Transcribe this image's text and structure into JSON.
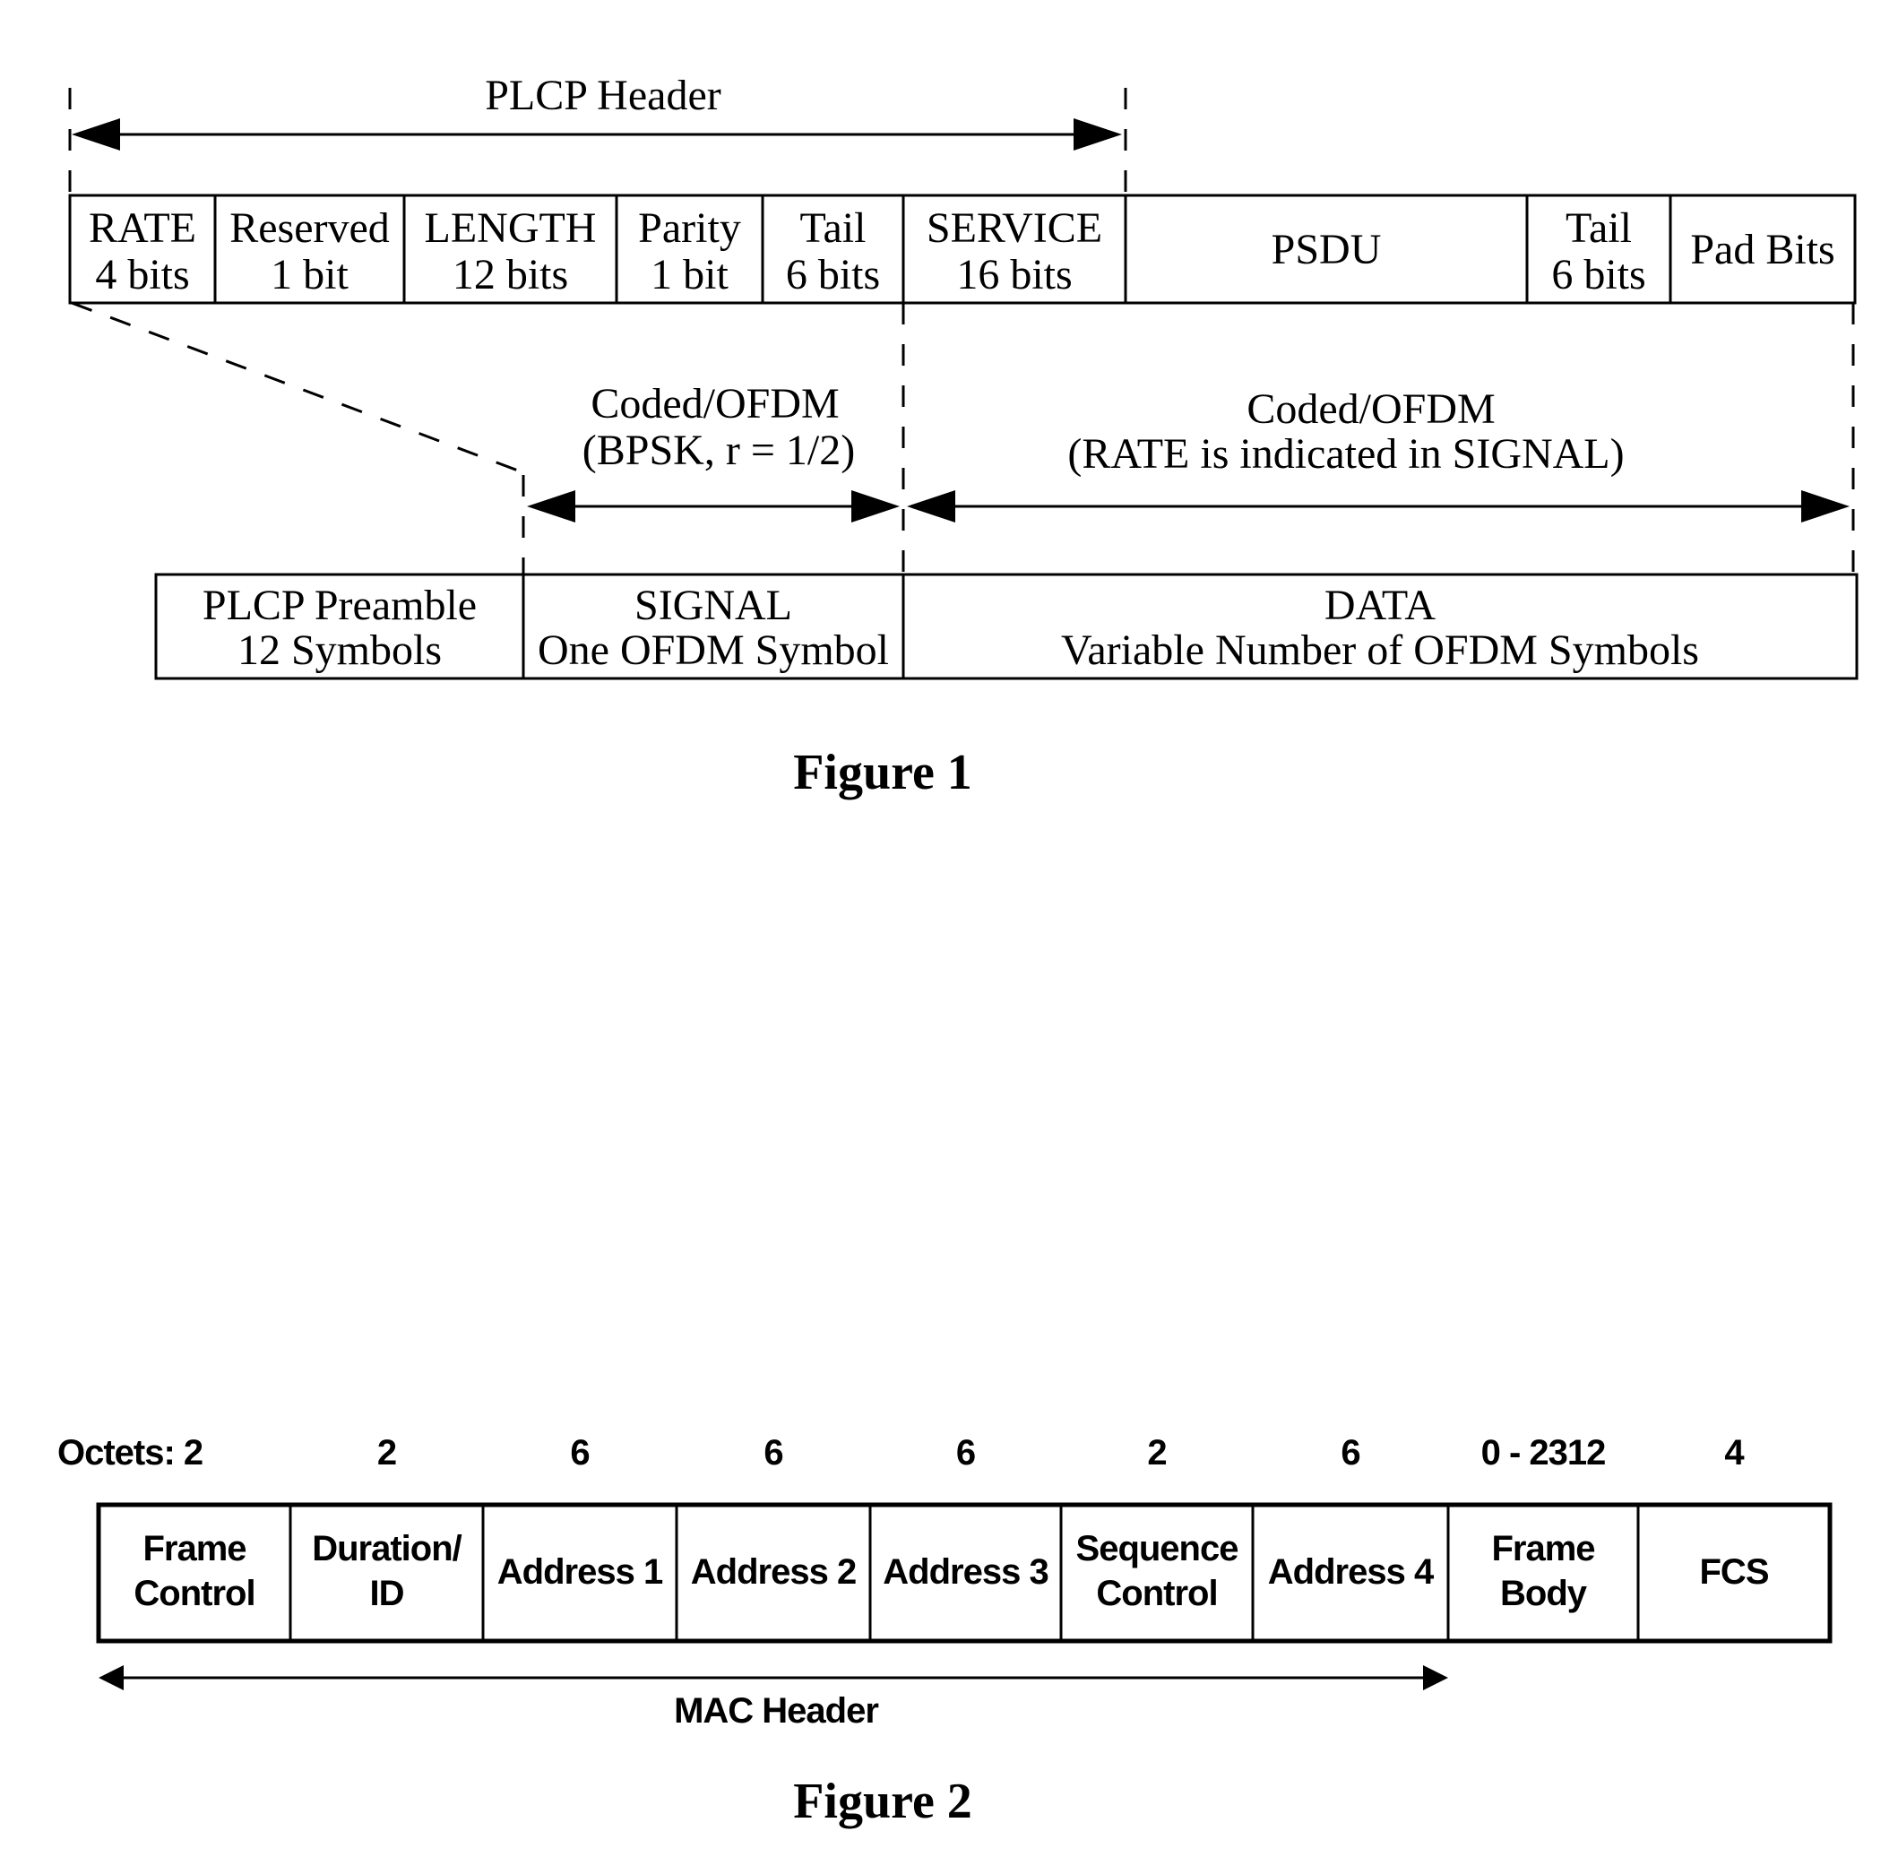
{
  "figure1": {
    "caption": "Figure 1",
    "plcp_header_label": "PLCP Header",
    "header_fields": [
      {
        "line1": "RATE",
        "line2": "4 bits"
      },
      {
        "line1": "Reserved",
        "line2": "1 bit"
      },
      {
        "line1": "LENGTH",
        "line2": "12 bits"
      },
      {
        "line1": "Parity",
        "line2": "1 bit"
      },
      {
        "line1": "Tail",
        "line2": "6 bits"
      },
      {
        "line1": "SERVICE",
        "line2": "16 bits"
      },
      {
        "line1": "PSDU",
        "line2": ""
      },
      {
        "line1": "Tail",
        "line2": "6 bits"
      },
      {
        "line1": "Pad Bits",
        "line2": ""
      }
    ],
    "signal_coding": {
      "line1": "Coded/OFDM",
      "line2": "(BPSK, r = 1/2)"
    },
    "data_coding": {
      "line1": "Coded/OFDM",
      "line2": "(RATE is indicated in SIGNAL)"
    },
    "ppdu_fields": [
      {
        "line1": "PLCP Preamble",
        "line2": "12 Symbols"
      },
      {
        "line1": "SIGNAL",
        "line2": "One OFDM Symbol"
      },
      {
        "line1": "DATA",
        "line2": "Variable Number of OFDM Symbols"
      }
    ]
  },
  "figure2": {
    "caption": "Figure 2",
    "octets_prefix": "Octets: ",
    "mac_header_label": "MAC Header",
    "fields": [
      {
        "octets": "2",
        "line1": "Frame",
        "line2": "Control"
      },
      {
        "octets": "2",
        "line1": "Duration/",
        "line2": "ID"
      },
      {
        "octets": "6",
        "line1": "Address 1",
        "line2": ""
      },
      {
        "octets": "6",
        "line1": "Address 2",
        "line2": ""
      },
      {
        "octets": "6",
        "line1": "Address 3",
        "line2": ""
      },
      {
        "octets": "2",
        "line1": "Sequence",
        "line2": "Control"
      },
      {
        "octets": "6",
        "line1": "Address 4",
        "line2": ""
      },
      {
        "octets": "0 - 2312",
        "line1": "Frame",
        "line2": "Body"
      },
      {
        "octets": "4",
        "line1": "FCS",
        "line2": ""
      }
    ]
  }
}
